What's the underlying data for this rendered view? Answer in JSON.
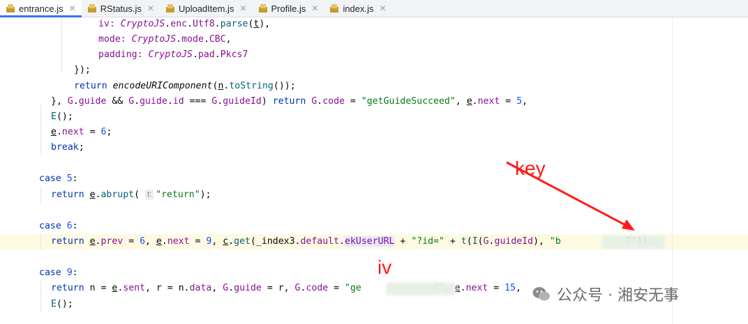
{
  "tabs": [
    {
      "label": "entrance.js",
      "active": true
    },
    {
      "label": "RStatus.js",
      "active": false
    },
    {
      "label": "UploadItem.js",
      "active": false
    },
    {
      "label": "Profile.js",
      "active": false
    },
    {
      "label": "index.js",
      "active": false
    }
  ],
  "code": {
    "l1": [
      "iv: ",
      "CryptoJS",
      ".",
      "enc",
      ".",
      "Utf8",
      ".",
      "parse",
      "(",
      "t",
      "),"
    ],
    "l2": [
      "mode: ",
      "CryptoJS",
      ".",
      "mode",
      ".",
      "CBC",
      ","
    ],
    "l3": [
      "padding: ",
      "CryptoJS",
      ".",
      "pad",
      ".",
      "Pkcs7"
    ],
    "l4": [
      "});"
    ],
    "l5": [
      "return ",
      "encodeURIComponent",
      "(",
      "n",
      ".",
      "toString",
      "());"
    ],
    "l6": [
      "}, ",
      "G",
      ".",
      "guide",
      " && ",
      "G",
      ".",
      "guide",
      ".",
      "id",
      " === ",
      "G",
      ".",
      "guideId",
      ") ",
      "return ",
      "G",
      ".",
      "code",
      " = ",
      "\"getGuideSucceed\"",
      ", ",
      "e",
      ".",
      "next",
      " = ",
      "5",
      ","
    ],
    "l7": [
      "E",
      "();"
    ],
    "l8": [
      "e",
      ".",
      "next",
      " = ",
      "6",
      ";"
    ],
    "l9": [
      "break",
      ";"
    ],
    "l10": [
      "case ",
      "5",
      ":"
    ],
    "l11": [
      "return ",
      "e",
      ".",
      "abrupt",
      "( ",
      "t:",
      " ",
      "\"return\"",
      ");"
    ],
    "l12": [
      "case ",
      "6",
      ":"
    ],
    "l13": [
      "return ",
      "e",
      ".",
      "prev",
      " = ",
      "6",
      ", ",
      "e",
      ".",
      "next",
      " = ",
      "9",
      ", ",
      "c",
      ".",
      "get",
      "(",
      "_index3",
      ".",
      "default",
      ".",
      "ekUserURL",
      " + ",
      "\"?id=\"",
      " + ",
      "t",
      "(",
      "I",
      "(",
      "G",
      ".",
      "guideId",
      "), ",
      "\"b",
      "7\"",
      "));"
    ],
    "l14": [
      "case ",
      "9",
      ":"
    ],
    "l15": [
      "return ",
      "n",
      " = ",
      "e",
      ".",
      "sent",
      ", ",
      "r",
      " = ",
      "n",
      ".",
      "data",
      ", ",
      "G",
      ".",
      "guide",
      " = ",
      "r",
      ", ",
      "G",
      ".",
      "code",
      " = ",
      "\"ge",
      "d\"",
      ", ",
      "e",
      ".",
      "next",
      " = ",
      "15",
      ","
    ],
    "l16": [
      "E",
      "();"
    ]
  },
  "annotations": {
    "key": "key",
    "iv": "iv"
  },
  "watermark": {
    "text": "公众号 · 湘安无事"
  },
  "colors": {
    "keyword": "#0033b3",
    "string": "#067d17",
    "number": "#1750eb",
    "property": "#871094",
    "annotation": "#ff1a1a"
  }
}
